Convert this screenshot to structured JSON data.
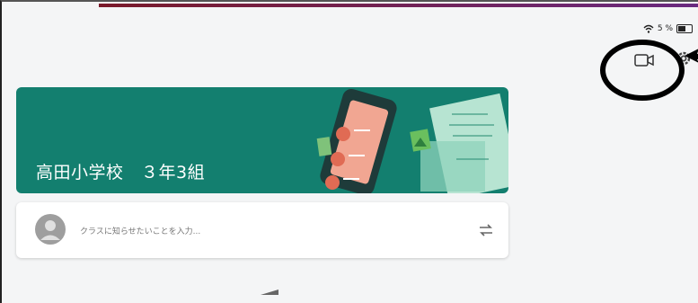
{
  "status_bar": {
    "battery_text": "5 %"
  },
  "class": {
    "title": "高田小学校　３年3組"
  },
  "post": {
    "placeholder": "クラスに知らせたいことを入力..."
  },
  "icons": {
    "video": "video-camera-icon",
    "settings": "gear-icon",
    "wifi": "wifi-icon",
    "battery": "battery-icon",
    "avatar": "avatar-icon",
    "repost": "repost-icon"
  },
  "colors": {
    "banner": "#137f6f",
    "page_bg": "#f4f5f6",
    "annotation": "#000000"
  }
}
